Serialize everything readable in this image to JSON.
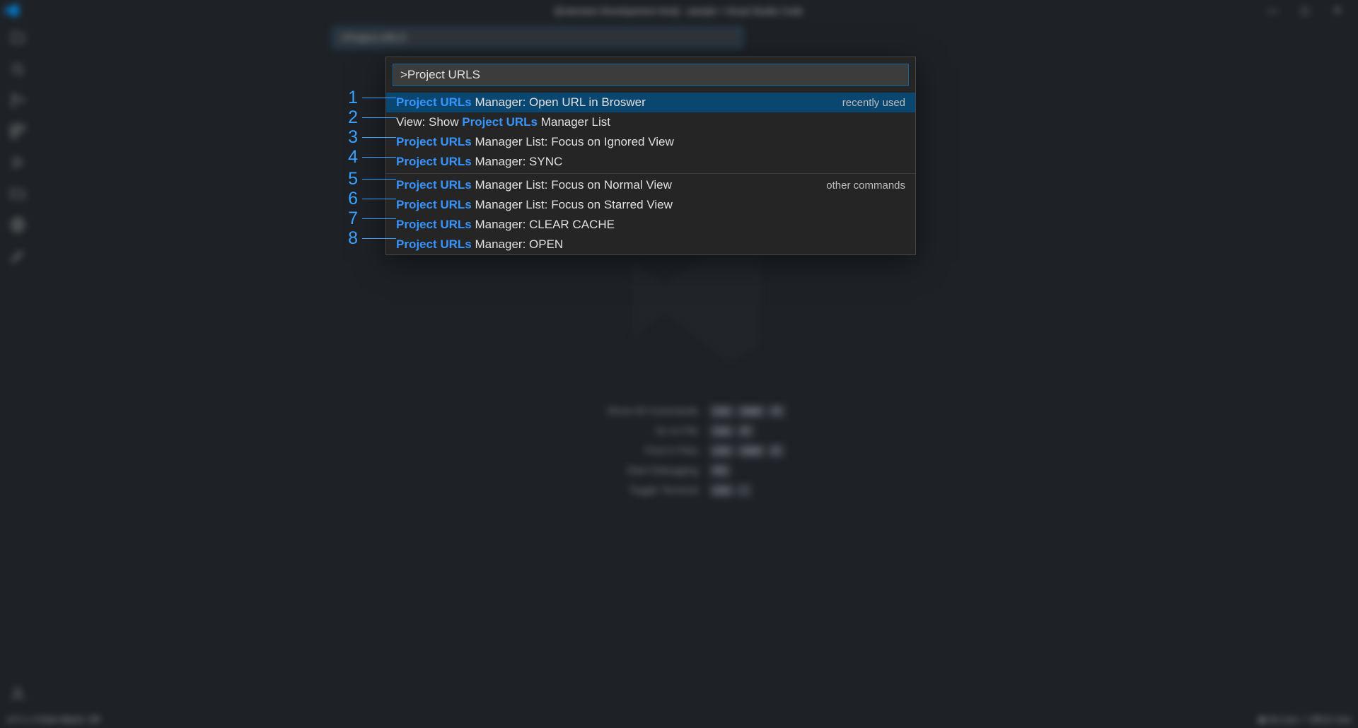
{
  "window_title": "[Extension Development Host] - sample • Visual Studio Code",
  "bg_quick_value": ">Project URLS",
  "quick_input_value": ">Project URLS",
  "results": [
    {
      "prefix": "Project URLs",
      "rest": " Manager: Open URL in Broswer",
      "hint": "recently used",
      "selected": true,
      "name": "cmd-open-url-in-browser"
    },
    {
      "prefix_leading": "View: Show ",
      "prefix": "Project URLs",
      "rest": " Manager List",
      "name": "cmd-show-manager-list"
    },
    {
      "prefix": "Project URLs",
      "rest": " Manager List: Focus on Ignored View",
      "name": "cmd-focus-ignored-view"
    },
    {
      "prefix": "Project URLs",
      "rest": " Manager: SYNC",
      "name": "cmd-sync"
    },
    {
      "separator": true
    },
    {
      "prefix": "Project URLs",
      "rest": " Manager List: Focus on Normal View",
      "hint": "other commands",
      "name": "cmd-focus-normal-view"
    },
    {
      "prefix": "Project URLs",
      "rest": " Manager List: Focus on Starred View",
      "name": "cmd-focus-starred-view"
    },
    {
      "prefix": "Project URLs",
      "rest": " Manager: CLEAR CACHE",
      "name": "cmd-clear-cache"
    },
    {
      "prefix": "Project URLs",
      "rest": " Manager: OPEN",
      "name": "cmd-open"
    }
  ],
  "callout_numbers": [
    "1",
    "2",
    "3",
    "4",
    "5",
    "6",
    "7",
    "8"
  ],
  "watermark_commands": [
    {
      "label": "Show All Commands",
      "keys": "Ctrl + Shift + P"
    },
    {
      "label": "Go to File",
      "keys": "Ctrl + P"
    },
    {
      "label": "Find in Files",
      "keys": "Ctrl + Shift + F"
    },
    {
      "label": "Start Debugging",
      "keys": "F5"
    },
    {
      "label": "Toggle Terminal",
      "keys": "Ctrl + `"
    }
  ],
  "status_left": "⊘ 0 ⚠ 0    Auto Attach: Off",
  "status_right": "◉ Go Live    ✓ URLS: true"
}
